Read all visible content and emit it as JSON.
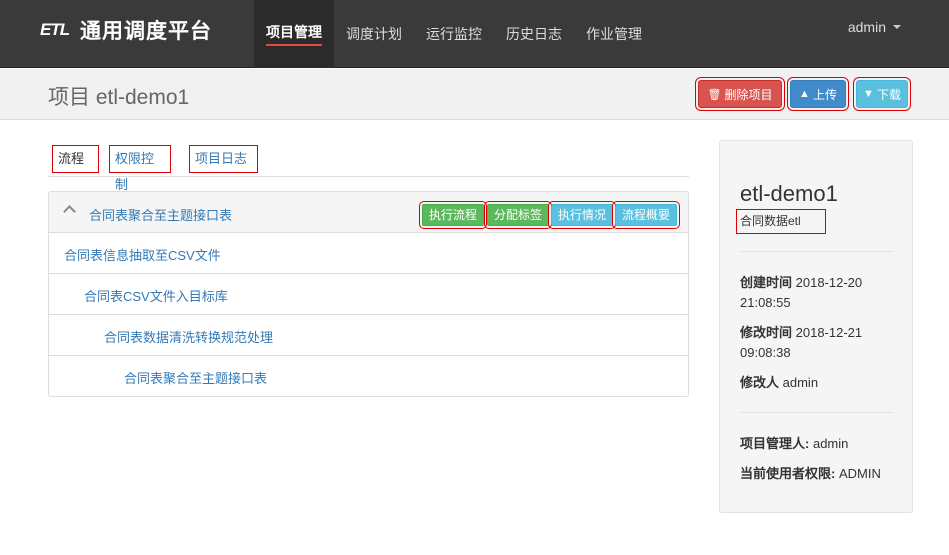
{
  "brand": {
    "logo": "ETL",
    "name": "通用调度平台"
  },
  "nav": [
    {
      "label": "项目管理",
      "active": true
    },
    {
      "label": "调度计划"
    },
    {
      "label": "运行监控"
    },
    {
      "label": "历史日志"
    },
    {
      "label": "作业管理"
    }
  ],
  "user": {
    "name": "admin"
  },
  "header": {
    "title": "项目 etl-demo1",
    "delete_label": "删除项目",
    "upload_label": "上传",
    "download_label": "下载",
    "delete_icon": "trash-icon",
    "upload_icon": "circle-arrow-up-icon",
    "download_icon": "circle-arrow-down-icon"
  },
  "tabs": [
    {
      "label": "流程",
      "active": true
    },
    {
      "label": "权限控制"
    },
    {
      "label": "项目日志"
    }
  ],
  "flow": {
    "name": "合同表聚合至主题接口表",
    "buttons": {
      "execute": "执行流程",
      "tags": "分配标签",
      "status": "执行情况",
      "summary": "流程概要"
    },
    "jobs": [
      "合同表信息抽取至CSV文件",
      "合同表CSV文件入目标库",
      "合同表数据清洗转换规范处理",
      "合同表聚合至主题接口表"
    ]
  },
  "project": {
    "name": "etl-demo1",
    "description": "合同数据etl",
    "created_label": "创建时间",
    "created_date": "2018-12-20",
    "created_time": "21:08:55",
    "modified_label": "修改时间",
    "modified_date": "2018-12-21",
    "modified_time": "09:08:38",
    "modifier_label": "修改人",
    "modifier": "admin",
    "manager_label": "项目管理人:",
    "manager": "admin",
    "permission_label": "当前使用者权限:",
    "permission": "ADMIN"
  },
  "colors": {
    "navbar": "#3a3a3a",
    "danger": "#d9534f",
    "primary": "#428bca",
    "info": "#5bc0de",
    "success": "#5cb85c",
    "link": "#337ab7",
    "annotation": "#dd0000"
  }
}
